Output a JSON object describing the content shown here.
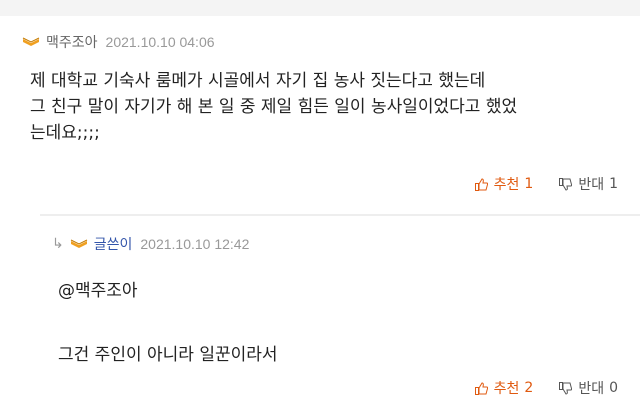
{
  "comment": {
    "author": "맥주조아",
    "date": "2021.10.10 04:06",
    "lines": [
      "제 대학교 기숙사 룸메가 시골에서 자기 집 농사 짓는다고 했는데",
      "그 친구 말이 자기가 해 본 일 중 제일 힘든 일이 농사일이었다고 했었",
      "는데요;;;;"
    ],
    "recommend_label": "추천",
    "recommend_count": "1",
    "oppose_label": "반대",
    "oppose_count": "1"
  },
  "reply": {
    "author": "글쓴이",
    "date": "2021.10.10 12:42",
    "mention": "@맥주조아",
    "text": "그건 주인이 아니라 일꾼이라서",
    "recommend_label": "추천",
    "recommend_count": "2",
    "oppose_label": "반대",
    "oppose_count": "0"
  },
  "colors": {
    "recommend": "#e05a10",
    "level_icon": "#f0a020",
    "writer_name": "#3355aa"
  },
  "icons": {
    "level": "level-badge-icon",
    "recommend": "thumbs-up-icon",
    "oppose": "thumbs-down-icon",
    "reply_arrow": "reply-arrow-icon"
  }
}
